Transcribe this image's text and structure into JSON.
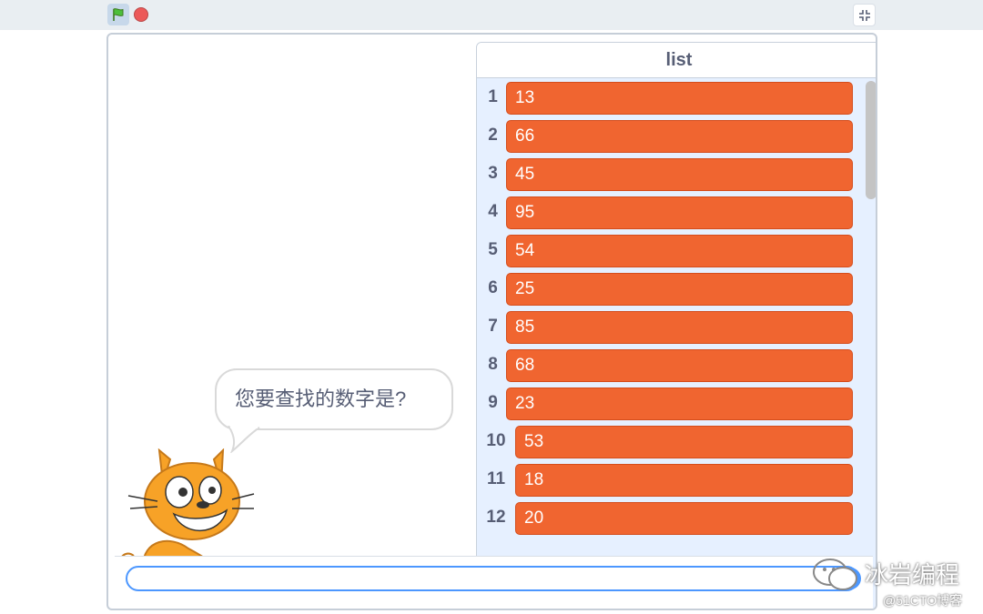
{
  "toolbar": {
    "green_flag_icon": "green-flag-icon",
    "stop_icon": "stop-icon",
    "fullscreen_icon": "unfullscreen-icon"
  },
  "list_monitor": {
    "title": "list",
    "items": [
      {
        "index": "1",
        "value": "13"
      },
      {
        "index": "2",
        "value": "66"
      },
      {
        "index": "3",
        "value": "45"
      },
      {
        "index": "4",
        "value": "95"
      },
      {
        "index": "5",
        "value": "54"
      },
      {
        "index": "6",
        "value": "25"
      },
      {
        "index": "7",
        "value": "85"
      },
      {
        "index": "8",
        "value": "68"
      },
      {
        "index": "9",
        "value": "23"
      },
      {
        "index": "10",
        "value": "53"
      },
      {
        "index": "11",
        "value": "18"
      },
      {
        "index": "12",
        "value": "20"
      }
    ]
  },
  "speech_bubble": {
    "text": "您要查找的数字是?"
  },
  "ask_prompt": {
    "value": ""
  },
  "watermark": {
    "main": "冰岩编程",
    "sub": "@51CTO博客"
  },
  "colors": {
    "list_item": "#f06530",
    "monitor_bg": "#e6f0ff",
    "input_border": "#4c97ff",
    "stop": "#ec5959"
  }
}
